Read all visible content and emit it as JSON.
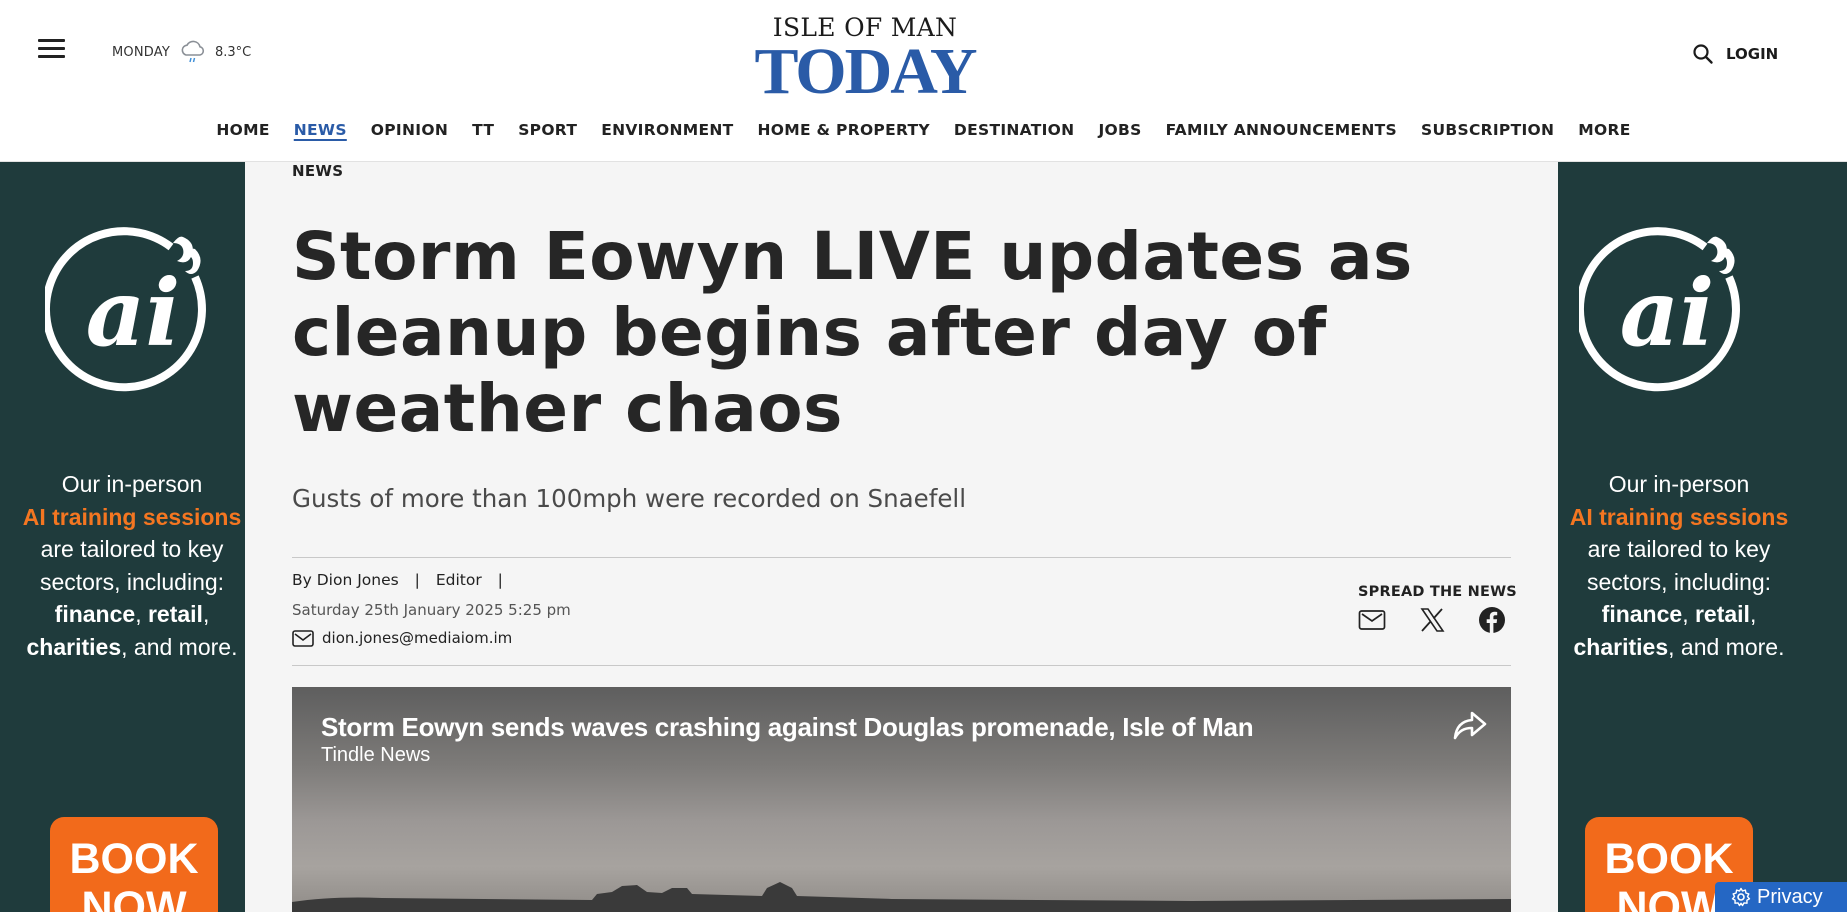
{
  "header": {
    "weather": {
      "day": "MONDAY",
      "temp": "8.3°C",
      "icon": "rain-cloud-icon"
    },
    "logo": {
      "top": "ISLE OF MAN",
      "main": "TODAY",
      "color": "#2a5ba7"
    },
    "login": "LOGIN"
  },
  "nav": {
    "active": "NEWS",
    "items": [
      "HOME",
      "NEWS",
      "OPINION",
      "TT",
      "SPORT",
      "ENVIRONMENT",
      "HOME & PROPERTY",
      "DESTINATION",
      "JOBS",
      "FAMILY ANNOUNCEMENTS",
      "SUBSCRIPTION",
      "MORE"
    ]
  },
  "ad": {
    "logo_text": "ai",
    "line1": "Our in-person",
    "highlight": "AI training sessions",
    "line2": "are tailored to key sectors, including:",
    "sectors": [
      "finance",
      "retail",
      "charities"
    ],
    "end": ", and more.",
    "cta": "BOOK NOW",
    "bg": "#1f3b3c",
    "accent": "#f26a1b"
  },
  "article": {
    "section": "NEWS",
    "headline": "Storm Eowyn LIVE updates as cleanup begins after day of weather chaos",
    "standfirst": "Gusts of more than 100mph were recorded on Snaefell",
    "author_prefix": "By",
    "author": "Dion Jones",
    "role": "Editor",
    "sep": "|",
    "date": "Saturday 25th January 2025 5:25 pm",
    "email": "dion.jones@mediaiom.im",
    "share_label": "SPREAD THE NEWS",
    "share_icons": [
      "email-icon",
      "x-icon",
      "facebook-icon"
    ]
  },
  "video": {
    "title": "Storm Eowyn sends waves crashing against Douglas promenade, Isle of Man",
    "source": "Tindle News"
  },
  "privacy": "Privacy"
}
